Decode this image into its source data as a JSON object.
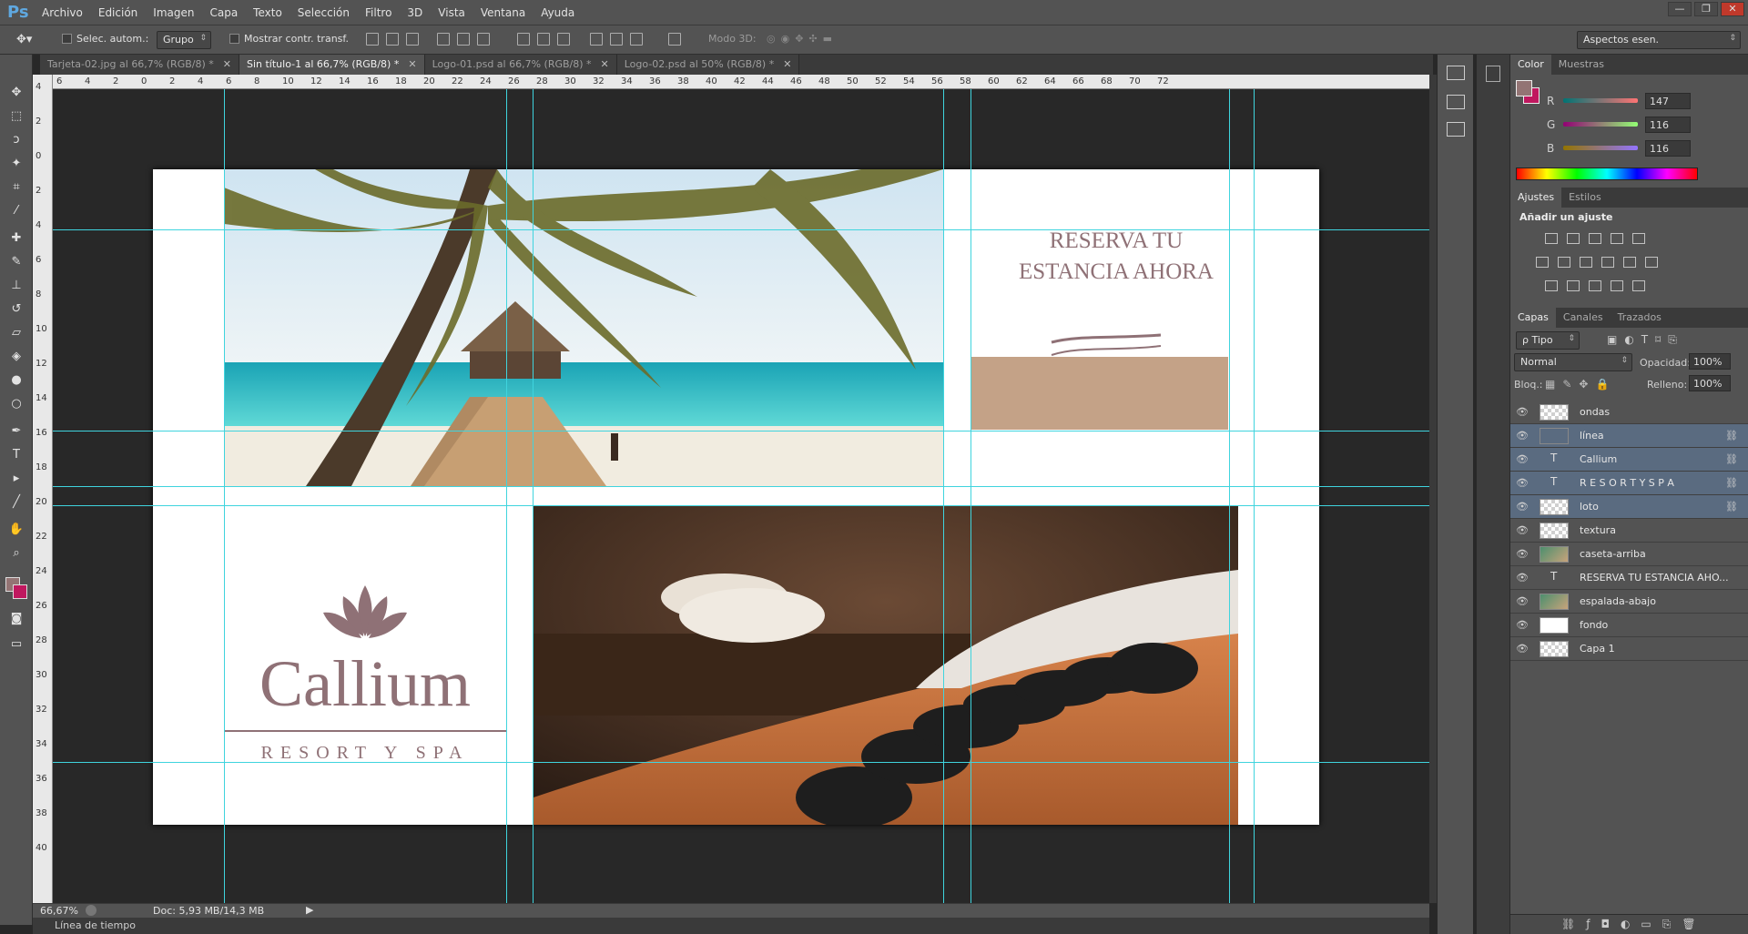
{
  "app": {
    "logo": "Ps"
  },
  "menu": [
    "Archivo",
    "Edición",
    "Imagen",
    "Capa",
    "Texto",
    "Selección",
    "Filtro",
    "3D",
    "Vista",
    "Ventana",
    "Ayuda"
  ],
  "window_controls": {
    "minimize": "—",
    "restore": "❐",
    "close": "✕"
  },
  "options": {
    "auto_select": "Selec. autom.:",
    "group_value": "Grupo",
    "show_transform": "Mostrar contr. transf.",
    "mode3d": "Modo 3D:",
    "workspace": "Aspectos esen."
  },
  "tabs": [
    {
      "label": "Tarjeta-02.jpg al 66,7% (RGB/8) *",
      "close": "✕"
    },
    {
      "label": "Sin título-1 al 66,7% (RGB/8) *",
      "close": "✕"
    },
    {
      "label": "Logo-01.psd al 66,7% (RGB/8) *",
      "close": "✕"
    },
    {
      "label": "Logo-02.psd al 50% (RGB/8) *",
      "close": "✕"
    }
  ],
  "ruler_h": [
    "6",
    "4",
    "2",
    "0",
    "2",
    "4",
    "6",
    "8",
    "10",
    "12",
    "14",
    "16",
    "18",
    "20",
    "22",
    "24",
    "26",
    "28",
    "30",
    "32",
    "34",
    "36",
    "38",
    "40",
    "42",
    "44",
    "46",
    "48",
    "50",
    "52",
    "54",
    "56",
    "58",
    "60",
    "62",
    "64",
    "66",
    "68",
    "70",
    "72"
  ],
  "ruler_v": [
    "4",
    "2",
    "0",
    "2",
    "4",
    "6",
    "8",
    "10",
    "12",
    "14",
    "16",
    "18",
    "20",
    "22",
    "24",
    "26",
    "28",
    "30",
    "32",
    "34",
    "36",
    "38",
    "40"
  ],
  "document": {
    "headline": "RESERVA TU ESTANCIA AHORA",
    "headline_lines": [
      "RESERVA TU",
      "ESTANCIA AHORA"
    ],
    "brand": "Callium",
    "tagline": "RESORT Y SPA",
    "accent_color": "#8f7176",
    "sand_color": "#c4a287"
  },
  "status": {
    "zoom": "66,67%",
    "doc": "Doc: 5,93 MB/14,3 MB"
  },
  "timeline": "Línea de tiempo",
  "color_panel": {
    "tabs": [
      "Color",
      "Muestras"
    ],
    "fg": "#937474",
    "bg": "#c0185f",
    "channels": [
      {
        "label": "R",
        "value": "147"
      },
      {
        "label": "G",
        "value": "116"
      },
      {
        "label": "B",
        "value": "116"
      }
    ]
  },
  "adjust_panel": {
    "tabs": [
      "Ajustes",
      "Estilos"
    ],
    "title": "Añadir un ajuste"
  },
  "layers_panel": {
    "tabs": [
      "Capas",
      "Canales",
      "Trazados"
    ],
    "filter": "ρ Tipo",
    "blend": "Normal",
    "opacity_label": "Opacidad:",
    "opacity": "100%",
    "lock_label": "Bloq.:",
    "fill_label": "Relleno:",
    "fill": "100%",
    "layers": [
      {
        "name": "ondas",
        "kind": "pixel",
        "selected": false,
        "linked": false
      },
      {
        "name": "línea",
        "kind": "shape",
        "selected": true,
        "linked": true
      },
      {
        "name": "Callium",
        "kind": "text",
        "selected": true,
        "linked": true
      },
      {
        "name": "R E S O R T  Y  S P A",
        "kind": "text",
        "selected": true,
        "linked": true
      },
      {
        "name": "loto",
        "kind": "pixel",
        "selected": true,
        "linked": true
      },
      {
        "name": "textura",
        "kind": "pixel",
        "selected": false,
        "linked": false
      },
      {
        "name": "caseta-arriba",
        "kind": "image",
        "selected": false,
        "linked": false
      },
      {
        "name": "RESERVA TU ESTANCIA AHO...",
        "kind": "text",
        "selected": false,
        "linked": false
      },
      {
        "name": "espalada-abajo",
        "kind": "image",
        "selected": false,
        "linked": false
      },
      {
        "name": "fondo",
        "kind": "white",
        "selected": false,
        "linked": false
      },
      {
        "name": "Capa 1",
        "kind": "pixel",
        "selected": false,
        "linked": false
      }
    ]
  }
}
